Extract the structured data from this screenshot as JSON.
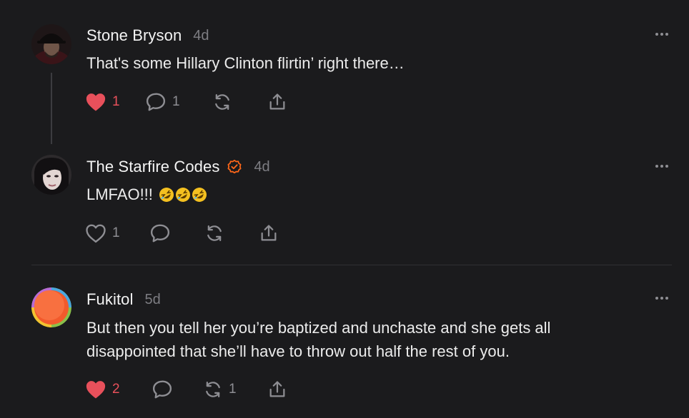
{
  "comments": [
    {
      "author": "Stone Bryson",
      "time": "4d",
      "text": "That's some Hillary Clinton flirtin’ right there…",
      "verified": false,
      "actions": {
        "like_count": "1",
        "liked": true,
        "reply_count": "1",
        "restack_count": ""
      }
    },
    {
      "author": "The Starfire Codes",
      "time": "4d",
      "text": "LMFAO!!!",
      "emoji": "🤣🤣🤣",
      "verified": true,
      "actions": {
        "like_count": "1",
        "liked": false,
        "reply_count": "",
        "restack_count": ""
      }
    },
    {
      "author": "Fukitol",
      "time": "5d",
      "text": "But then you tell her you’re baptized and unchaste and she gets all disappointed that she’ll have to throw out half the rest of you.",
      "verified": false,
      "actions": {
        "like_count": "2",
        "liked": true,
        "reply_count": "",
        "restack_count": "1"
      }
    }
  ],
  "icons": {
    "like": "heart-icon",
    "reply": "comment-bubble-icon",
    "restack": "restack-icon",
    "share": "share-icon",
    "more": "more-options-icon",
    "verified": "verified-badge-icon"
  },
  "colors": {
    "background": "#1b1b1d",
    "liked": "#e8505b",
    "accent": "#ff6719",
    "muted": "#8e8e93"
  }
}
